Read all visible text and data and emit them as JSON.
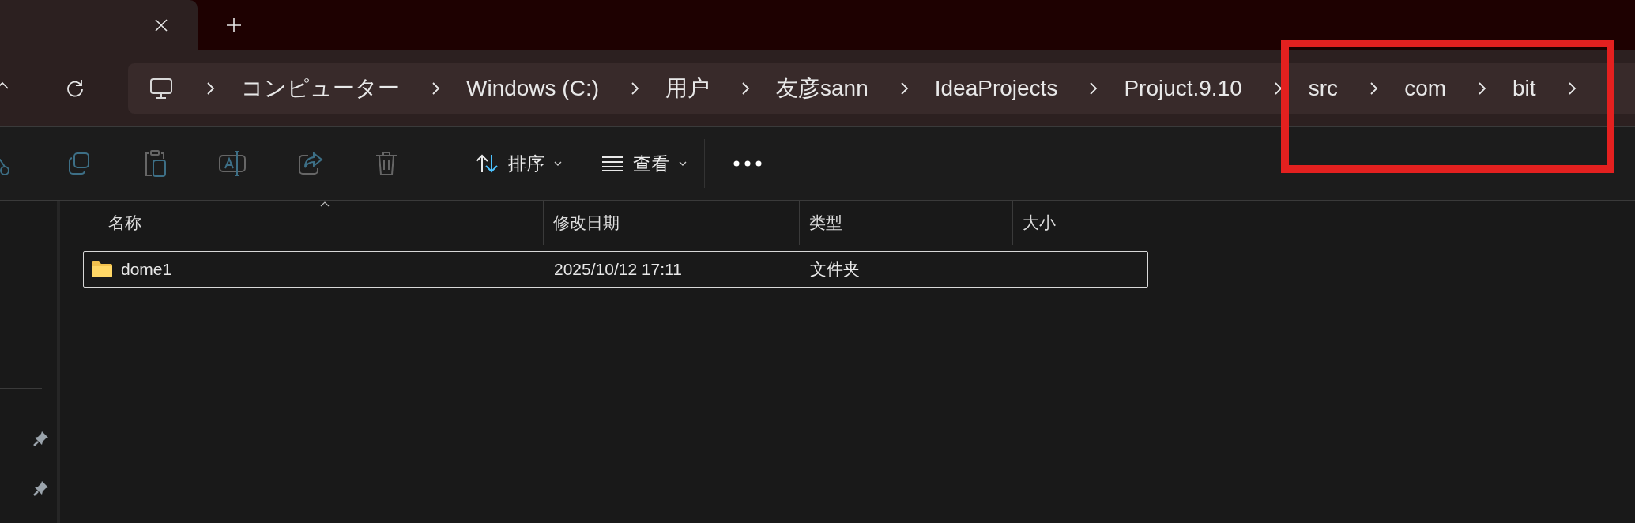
{
  "breadcrumb": [
    "コンピューター",
    "Windows (C:)",
    "用户",
    "友彦sann",
    "IdeaProjects",
    "Projuct.9.10",
    "src",
    "com",
    "bit"
  ],
  "toolbar": {
    "sort": "排序",
    "view": "查看"
  },
  "table": {
    "columns": [
      {
        "label": "名称",
        "sorted": true
      },
      {
        "label": "修改日期",
        "sorted": false
      },
      {
        "label": "类型",
        "sorted": false
      },
      {
        "label": "大小",
        "sorted": false
      }
    ],
    "rows": [
      {
        "name": "dome1",
        "modified": "2025/10/12 17:11",
        "type": "文件夹",
        "selected": true
      }
    ]
  },
  "annotations": [
    {
      "kind": "rectangle"
    }
  ]
}
